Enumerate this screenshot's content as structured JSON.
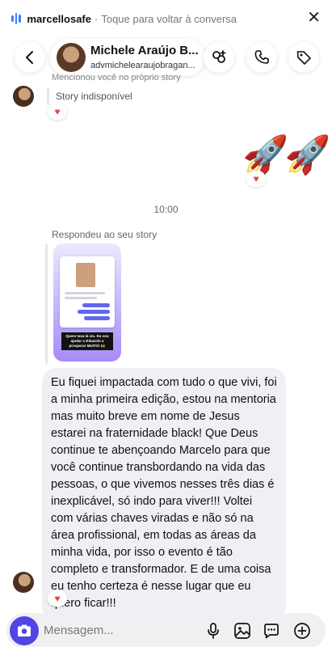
{
  "banner": {
    "username": "marcellosafe",
    "separator": "·",
    "hint": "Toque para voltar à conversa",
    "close": "✕"
  },
  "header": {
    "name": "Michele Araújo B...",
    "handle": "advmichelearaujobragan..."
  },
  "messages": {
    "mention_note": "Mencionou você no próprio story",
    "story_unavailable": "Story indisponível",
    "reaction": "♥",
    "rockets": "🚀",
    "timestamp": "10:00",
    "replied_label": "Respondeu ao seu story",
    "story_caption": "Quem tava lá viu. Eu vou ajudar o Eduardo a prosperar MUITO! 🙌",
    "reply_text": "Eu fiquei impactada com tudo o que vivi, foi a minha primeira edição, estou na mentoria mas muito breve em nome de Jesus estarei na fraternidade black! Que Deus continue te abençoando Marcelo para que você continue transbordando na vida das pessoas, o que vivemos nesses três dias é inexplicável, só indo para viver!!! Voltei com várias chaves viradas e não só na área profissional, em todas as áreas da minha vida, por isso o evento é tão completo e transformador. E de uma coisa eu tenho certeza é nesse lugar que eu quero ficar!!!"
  },
  "composer": {
    "placeholder": "Mensagem..."
  },
  "icons": {
    "back": "chevron-left-icon",
    "add_people": "add-people-icon",
    "call": "phone-icon",
    "tag": "tag-icon",
    "camera": "camera-icon",
    "mic": "microphone-icon",
    "gallery": "gallery-icon",
    "sticker": "sticker-icon",
    "plus": "plus-icon"
  },
  "colors": {
    "accent": "#4f46e5",
    "reaction": "#ef4444",
    "bubble": "#efeff4",
    "audio_wave": "#3b82f6"
  }
}
